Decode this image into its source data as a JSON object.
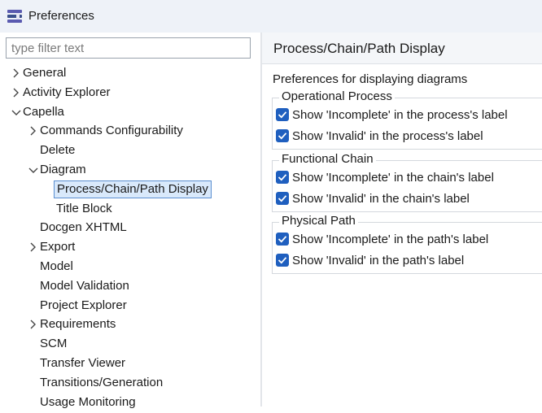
{
  "window": {
    "title": "Preferences"
  },
  "filter": {
    "placeholder": "type filter text"
  },
  "tree": [
    {
      "label": "General",
      "expander": "collapsed"
    },
    {
      "label": "Activity Explorer",
      "expander": "collapsed"
    },
    {
      "label": "Capella",
      "expander": "expanded"
    },
    {
      "label": "Commands Configurability",
      "expander": "collapsed"
    },
    {
      "label": "Delete",
      "expander": "none"
    },
    {
      "label": "Diagram",
      "expander": "expanded"
    },
    {
      "label": "Process/Chain/Path Display",
      "expander": "none",
      "selected": true
    },
    {
      "label": "Title Block",
      "expander": "none"
    },
    {
      "label": "Docgen XHTML",
      "expander": "none"
    },
    {
      "label": "Export",
      "expander": "collapsed"
    },
    {
      "label": "Model",
      "expander": "none"
    },
    {
      "label": "Model Validation",
      "expander": "none"
    },
    {
      "label": "Project Explorer",
      "expander": "none"
    },
    {
      "label": "Requirements",
      "expander": "collapsed"
    },
    {
      "label": "SCM",
      "expander": "none"
    },
    {
      "label": "Transfer Viewer",
      "expander": "none"
    },
    {
      "label": "Transitions/Generation",
      "expander": "none"
    },
    {
      "label": "Usage Monitoring",
      "expander": "none"
    }
  ],
  "page": {
    "title": "Process/Chain/Path Display",
    "description": "Preferences for displaying diagrams",
    "groups": [
      {
        "legend": "Operational Process",
        "options": [
          {
            "label": "Show 'Incomplete' in the process's label",
            "checked": true
          },
          {
            "label": "Show 'Invalid' in the process's label",
            "checked": true
          }
        ]
      },
      {
        "legend": "Functional Chain",
        "options": [
          {
            "label": "Show 'Incomplete' in the chain's label",
            "checked": true
          },
          {
            "label": "Show 'Invalid' in the chain's label",
            "checked": true
          }
        ]
      },
      {
        "legend": "Physical Path",
        "options": [
          {
            "label": "Show 'Incomplete' in the path's label",
            "checked": true
          },
          {
            "label": "Show 'Invalid' in the path's label",
            "checked": true
          }
        ]
      }
    ]
  },
  "colors": {
    "accent": "#1f5fbf",
    "selection_bg": "#d9e9fb",
    "selection_border": "#5b8fd0",
    "titlebar_bg": "#eef2f8"
  },
  "icons": {
    "app": "preferences-icon",
    "collapsed": "chevron-right-icon",
    "expanded": "chevron-down-icon",
    "check": "checkmark-icon"
  }
}
